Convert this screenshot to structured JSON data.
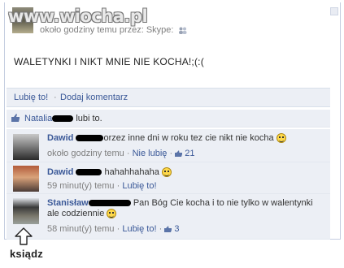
{
  "watermark": "www.wiocha.pl",
  "header": {
    "meta_text": "około godziny temu przez: Skype:"
  },
  "post": {
    "text": "WALETYNKI I NIKT MNIE NIE KOCHA!;(:("
  },
  "actions": {
    "like": "Lubię to!",
    "dot": "·",
    "comment": "Dodaj komentarz"
  },
  "likes": {
    "name": "Natalia",
    "text": "lubi to."
  },
  "comments": [
    {
      "name": "Dawid",
      "text": "orzez inne dni w roku tez cie nikt nie kocha",
      "time": "około godziny temu",
      "sep1": "·",
      "unlike": "Nie lubię",
      "sep2": "·",
      "likes": "21"
    },
    {
      "name": "Dawid",
      "text": "hahahhahaha",
      "time": "59 minut(y) temu",
      "sep1": "·",
      "like": "Lubię to!"
    },
    {
      "name": "Stanisław",
      "text": "Pan Bóg Cie kocha i to nie tylko w walentynki ale codziennie",
      "time": "58 minut(y) temu",
      "sep1": "·",
      "like": "Lubię to!",
      "sep2": "·",
      "likes": "3"
    }
  ],
  "caption": "ksiądz",
  "colors": {
    "link": "#3b5998",
    "panel": "#eceff5",
    "meta": "#7f7f7f"
  }
}
